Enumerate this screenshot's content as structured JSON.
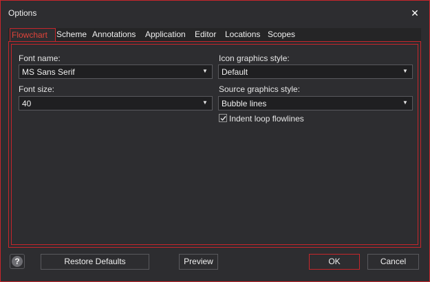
{
  "window": {
    "title": "Options",
    "close_glyph": "✕"
  },
  "tabs": [
    {
      "label": "Flowchart",
      "active": true
    },
    {
      "label": "Scheme",
      "active": false
    },
    {
      "label": "Annotations",
      "active": false
    },
    {
      "label": "Application",
      "active": false
    },
    {
      "label": "Editor",
      "active": false
    },
    {
      "label": "Locations",
      "active": false
    },
    {
      "label": "Scopes",
      "active": false
    }
  ],
  "flowchart": {
    "font_name": {
      "label": "Font name:",
      "value": "MS Sans Serif"
    },
    "font_size": {
      "label": "Font size:",
      "value": "40"
    },
    "icon_graphics_style": {
      "label": "Icon graphics style:",
      "value": "Default"
    },
    "source_graphics_style": {
      "label": "Source graphics style:",
      "value": "Bubble lines"
    },
    "indent_loop_flowlines": {
      "label": "Indent loop flowlines",
      "checked": true
    }
  },
  "footer": {
    "help_glyph": "?",
    "restore_defaults_label": "Restore Defaults",
    "preview_label": "Preview",
    "ok_label": "OK",
    "cancel_label": "Cancel"
  },
  "colors": {
    "accent": "#c8262b",
    "active_tab_text": "#e0443a",
    "background": "#2d2d30",
    "input_background": "#1f1f21"
  },
  "icons": {
    "dropdown": "chevron-down-icon",
    "help": "help-icon",
    "close": "close-icon",
    "check": "check-icon"
  }
}
